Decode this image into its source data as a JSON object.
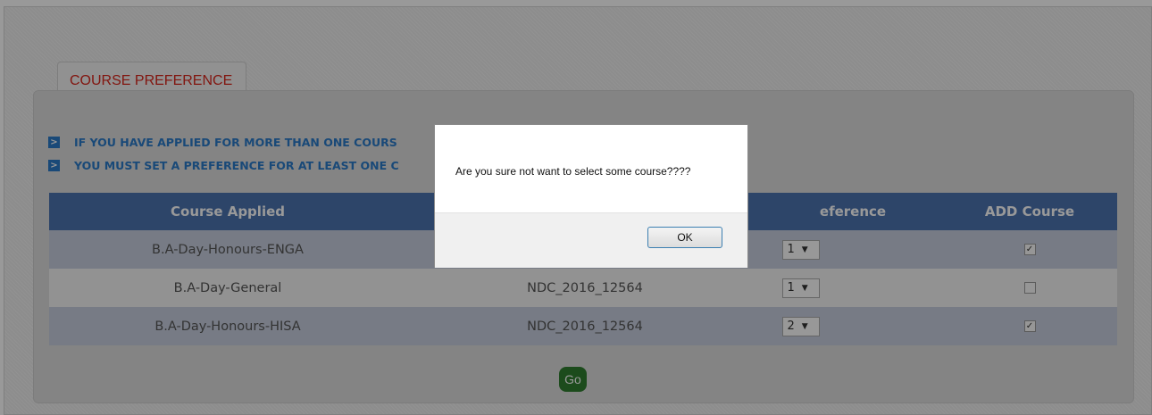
{
  "tab": {
    "label": "COURSE PREFERENCE"
  },
  "notes": [
    "IF YOU HAVE APPLIED FOR MORE THAN ONE COURS",
    "YOU MUST SET A PREFERENCE FOR AT LEAST ONE C"
  ],
  "note_icon": "chevron-right-icon",
  "table": {
    "headers": [
      "Course Applied",
      "",
      "eference",
      "ADD Course"
    ],
    "rows": [
      {
        "course": "B.A-Day-Honours-ENGA",
        "app_no": "",
        "preference": "1",
        "added": true
      },
      {
        "course": "B.A-Day-General",
        "app_no": "NDC_2016_12564",
        "preference": "1",
        "added": false
      },
      {
        "course": "B.A-Day-Honours-HISA",
        "app_no": "NDC_2016_12564",
        "preference": "2",
        "added": true
      }
    ]
  },
  "go_label": "Go",
  "dialog": {
    "message": "Are you sure not want to select some course????",
    "ok_label": "OK"
  },
  "colors": {
    "header": "#4c73b0",
    "accent_red": "#d9261c",
    "note_blue": "#2a7ac8",
    "go_green": "#2f7d2f"
  }
}
